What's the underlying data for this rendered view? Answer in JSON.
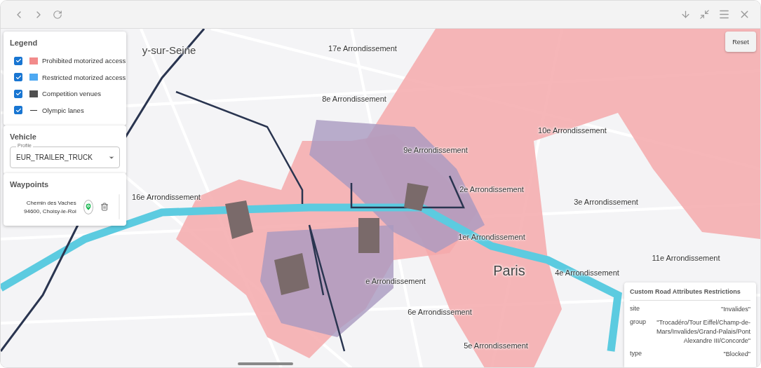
{
  "legend": {
    "title": "Legend",
    "items": [
      {
        "label": "Prohibited motorized access",
        "checked": true,
        "kind": "swatch",
        "color": "#f28b8b"
      },
      {
        "label": "Restricted motorized access",
        "checked": true,
        "kind": "swatch",
        "color": "#4ea9f2"
      },
      {
        "label": "Competition venues",
        "checked": true,
        "kind": "swatch",
        "color": "#505050"
      },
      {
        "label": "Olympic lanes",
        "checked": true,
        "kind": "line",
        "color": "#333333"
      }
    ]
  },
  "vehicle": {
    "title": "Vehicle",
    "profile_label": "Profile",
    "profile": "EUR_TRAILER_TRUCK"
  },
  "waypoints": {
    "title": "Waypoints",
    "items": [
      {
        "address_line_1": "Chemin des Vaches",
        "address_line_2": "94600, Choisy-le-Roi"
      }
    ]
  },
  "reset_button": "Reset",
  "map_labels": [
    {
      "text": "y-sur-Seine",
      "kind": "city"
    },
    {
      "text": "17e Arrondissement",
      "kind": "district"
    },
    {
      "text": "8e Arrondissement",
      "kind": "district"
    },
    {
      "text": "9e Arrondissement",
      "kind": "district"
    },
    {
      "text": "10e Arrondissement",
      "kind": "district"
    },
    {
      "text": "2e Arrondissement",
      "kind": "district"
    },
    {
      "text": "3e Arrondissement",
      "kind": "district"
    },
    {
      "text": "16e Arrondissement",
      "kind": "district"
    },
    {
      "text": "1er Arrondissement",
      "kind": "district"
    },
    {
      "text": "11e Arrondissement",
      "kind": "district"
    },
    {
      "text": "Paris",
      "kind": "capital"
    },
    {
      "text": "4e Arrondissement",
      "kind": "district"
    },
    {
      "text": "e Arrondissement",
      "kind": "district"
    },
    {
      "text": "6e Arrondissement",
      "kind": "district"
    },
    {
      "text": "5e Arrondissement",
      "kind": "district"
    }
  ],
  "restrictions": {
    "title": "Custom Road Attributes Restrictions",
    "rows": [
      {
        "key": "site",
        "value": "\"Invalides\""
      },
      {
        "key": "group",
        "value": "\"Trocadéro/Tour Eiffel/Champ-de-Mars/Invalides/Grand-Palais/Pont Alexandre III/Concorde\""
      },
      {
        "key": "type",
        "value": "\"Blocked\""
      }
    ]
  }
}
